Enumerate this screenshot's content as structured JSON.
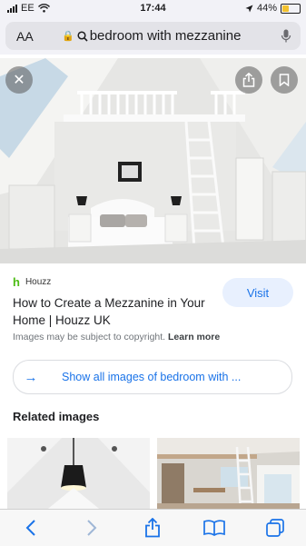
{
  "status": {
    "carrier": "EE",
    "time": "17:44",
    "battery": "44%",
    "battery_level": 0.44
  },
  "address_bar": {
    "text_size_label": "AA",
    "url": "bedroom with mezzanine"
  },
  "result": {
    "source": "Houzz",
    "title": "How to Create a Mezzanine in Your Home | Houzz UK",
    "visit_label": "Visit",
    "copyright_text": "Images may be subject to copyright.",
    "learn_more": "Learn more",
    "show_all_label": "Show all images of bedroom with ..."
  },
  "related_heading": "Related images",
  "icons": [
    "signal-icon",
    "wifi-icon",
    "location-icon",
    "battery-icon",
    "lock-icon",
    "search-icon",
    "mic-icon",
    "close-icon",
    "share-icon",
    "bookmark-icon",
    "arrow-right-icon",
    "back-icon",
    "forward-icon",
    "tabs-icon"
  ],
  "colors": {
    "accent": "#1a73e8",
    "houzz_green": "#4dbc15"
  }
}
